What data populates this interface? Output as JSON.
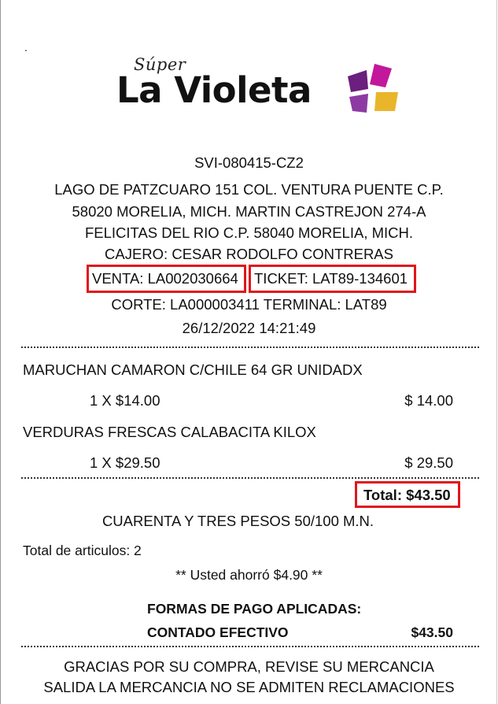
{
  "header": {
    "dot": ".",
    "logo_script": "Súper",
    "logo_name": "La Violeta",
    "store_code": "SVI-080415-CZ2",
    "address_lines": [
      "LAGO DE PATZCUARO 151 COL. VENTURA PUENTE C.P.",
      "58020 MORELIA, MICH.  MARTIN CASTREJON 274-A",
      "FELICITAS DEL RIO C.P. 58040 MORELIA, MICH."
    ],
    "cashier": "CAJERO: CESAR RODOLFO CONTRERAS",
    "sale": "VENTA: LA002030664",
    "ticket": "TICKET: LAT89-134601",
    "cut_terminal": "CORTE: LA000003411   TERMINAL: LAT89",
    "datetime": "26/12/2022  14:21:49"
  },
  "items": [
    {
      "description": "MARUCHAN CAMARON C/CHILE 64 GR UNIDADX",
      "quantity_line": "1   X  $14.00",
      "amount": "$ 14.00"
    },
    {
      "description": "VERDURAS FRESCAS CALABACITA KILOX",
      "quantity_line": "1   X  $29.50",
      "amount": "$ 29.50"
    }
  ],
  "totals": {
    "total": "Total: $43.50",
    "total_words": "CUARENTA Y TRES PESOS 50/100 M.N.",
    "item_count": "Total de articulos: 2",
    "savings": "** Usted ahorró $4.90 **"
  },
  "payment": {
    "heading": "FORMAS DE PAGO APLICADAS:",
    "method": "CONTADO EFECTIVO",
    "amount": "$43.50"
  },
  "footer": {
    "lines": [
      "GRACIAS POR SU COMPRA, REVISE SU MERCANCIA",
      "SALIDA LA MERCANCIA NO SE ADMITEN RECLAMACIONES"
    ]
  },
  "colors": {
    "highlight_box": "#e0161b",
    "logo_petals": [
      "#6b1f7e",
      "#c2189b",
      "#e9b52a",
      "#8e3aa3"
    ]
  }
}
